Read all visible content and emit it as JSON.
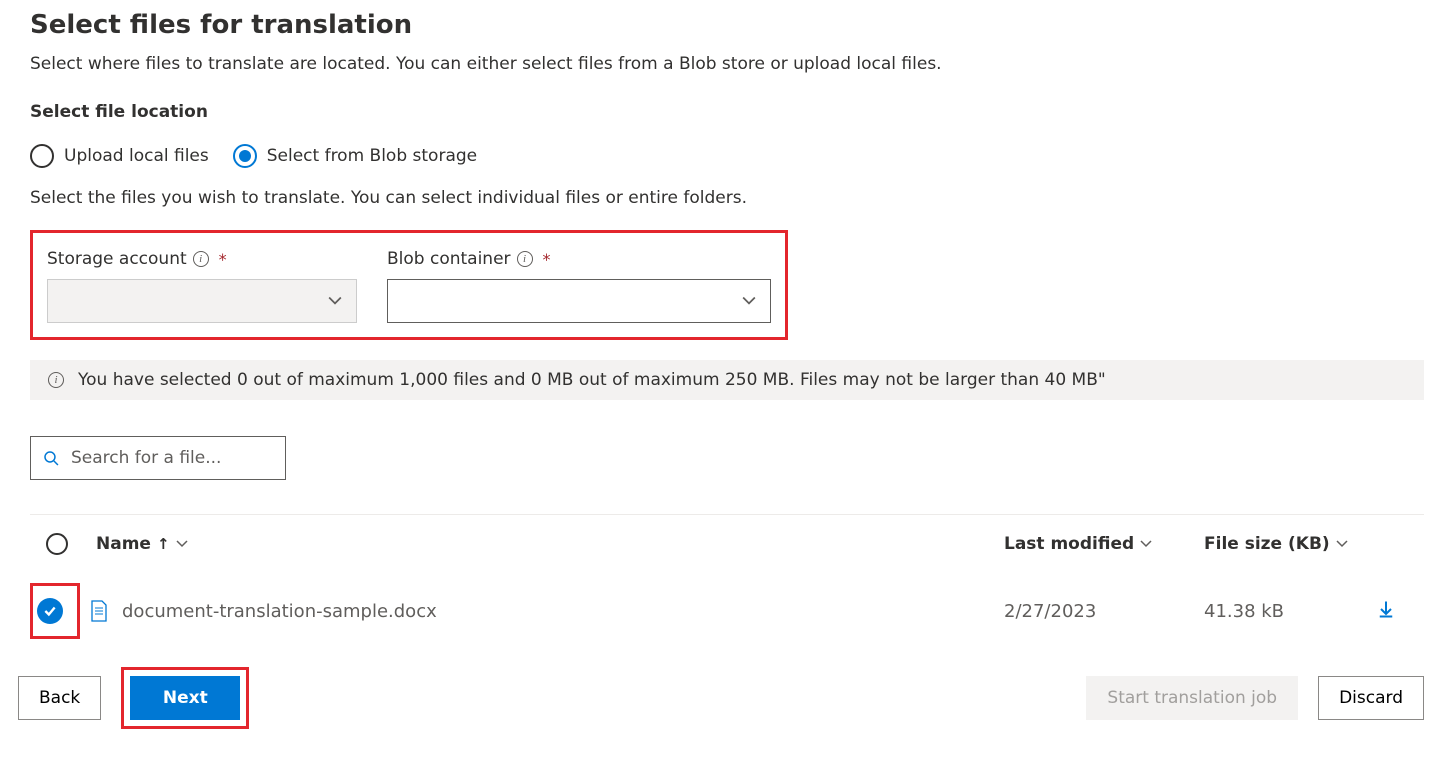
{
  "title": "Select files for translation",
  "description": "Select where files to translate are located. You can either select files from a Blob store or upload local files.",
  "section_label": "Select file location",
  "radio": {
    "upload_local": "Upload local files",
    "blob_storage": "Select from Blob storage"
  },
  "sub_desc": "Select the files you wish to translate. You can select individual files or entire folders.",
  "fields": {
    "storage_account": "Storage account",
    "blob_container": "Blob container"
  },
  "info_bar": "You have selected 0 out of maximum 1,000 files and 0 MB out of maximum 250 MB. Files may not be larger than 40 MB\"",
  "search_placeholder": "Search for a file...",
  "columns": {
    "name": "Name",
    "last_modified": "Last modified",
    "file_size": "File size (KB)"
  },
  "row": {
    "name": "document-translation-sample.docx",
    "modified": "2/27/2023",
    "size": "41.38 kB"
  },
  "buttons": {
    "back": "Back",
    "next": "Next",
    "start_job": "Start translation job",
    "discard": "Discard"
  }
}
